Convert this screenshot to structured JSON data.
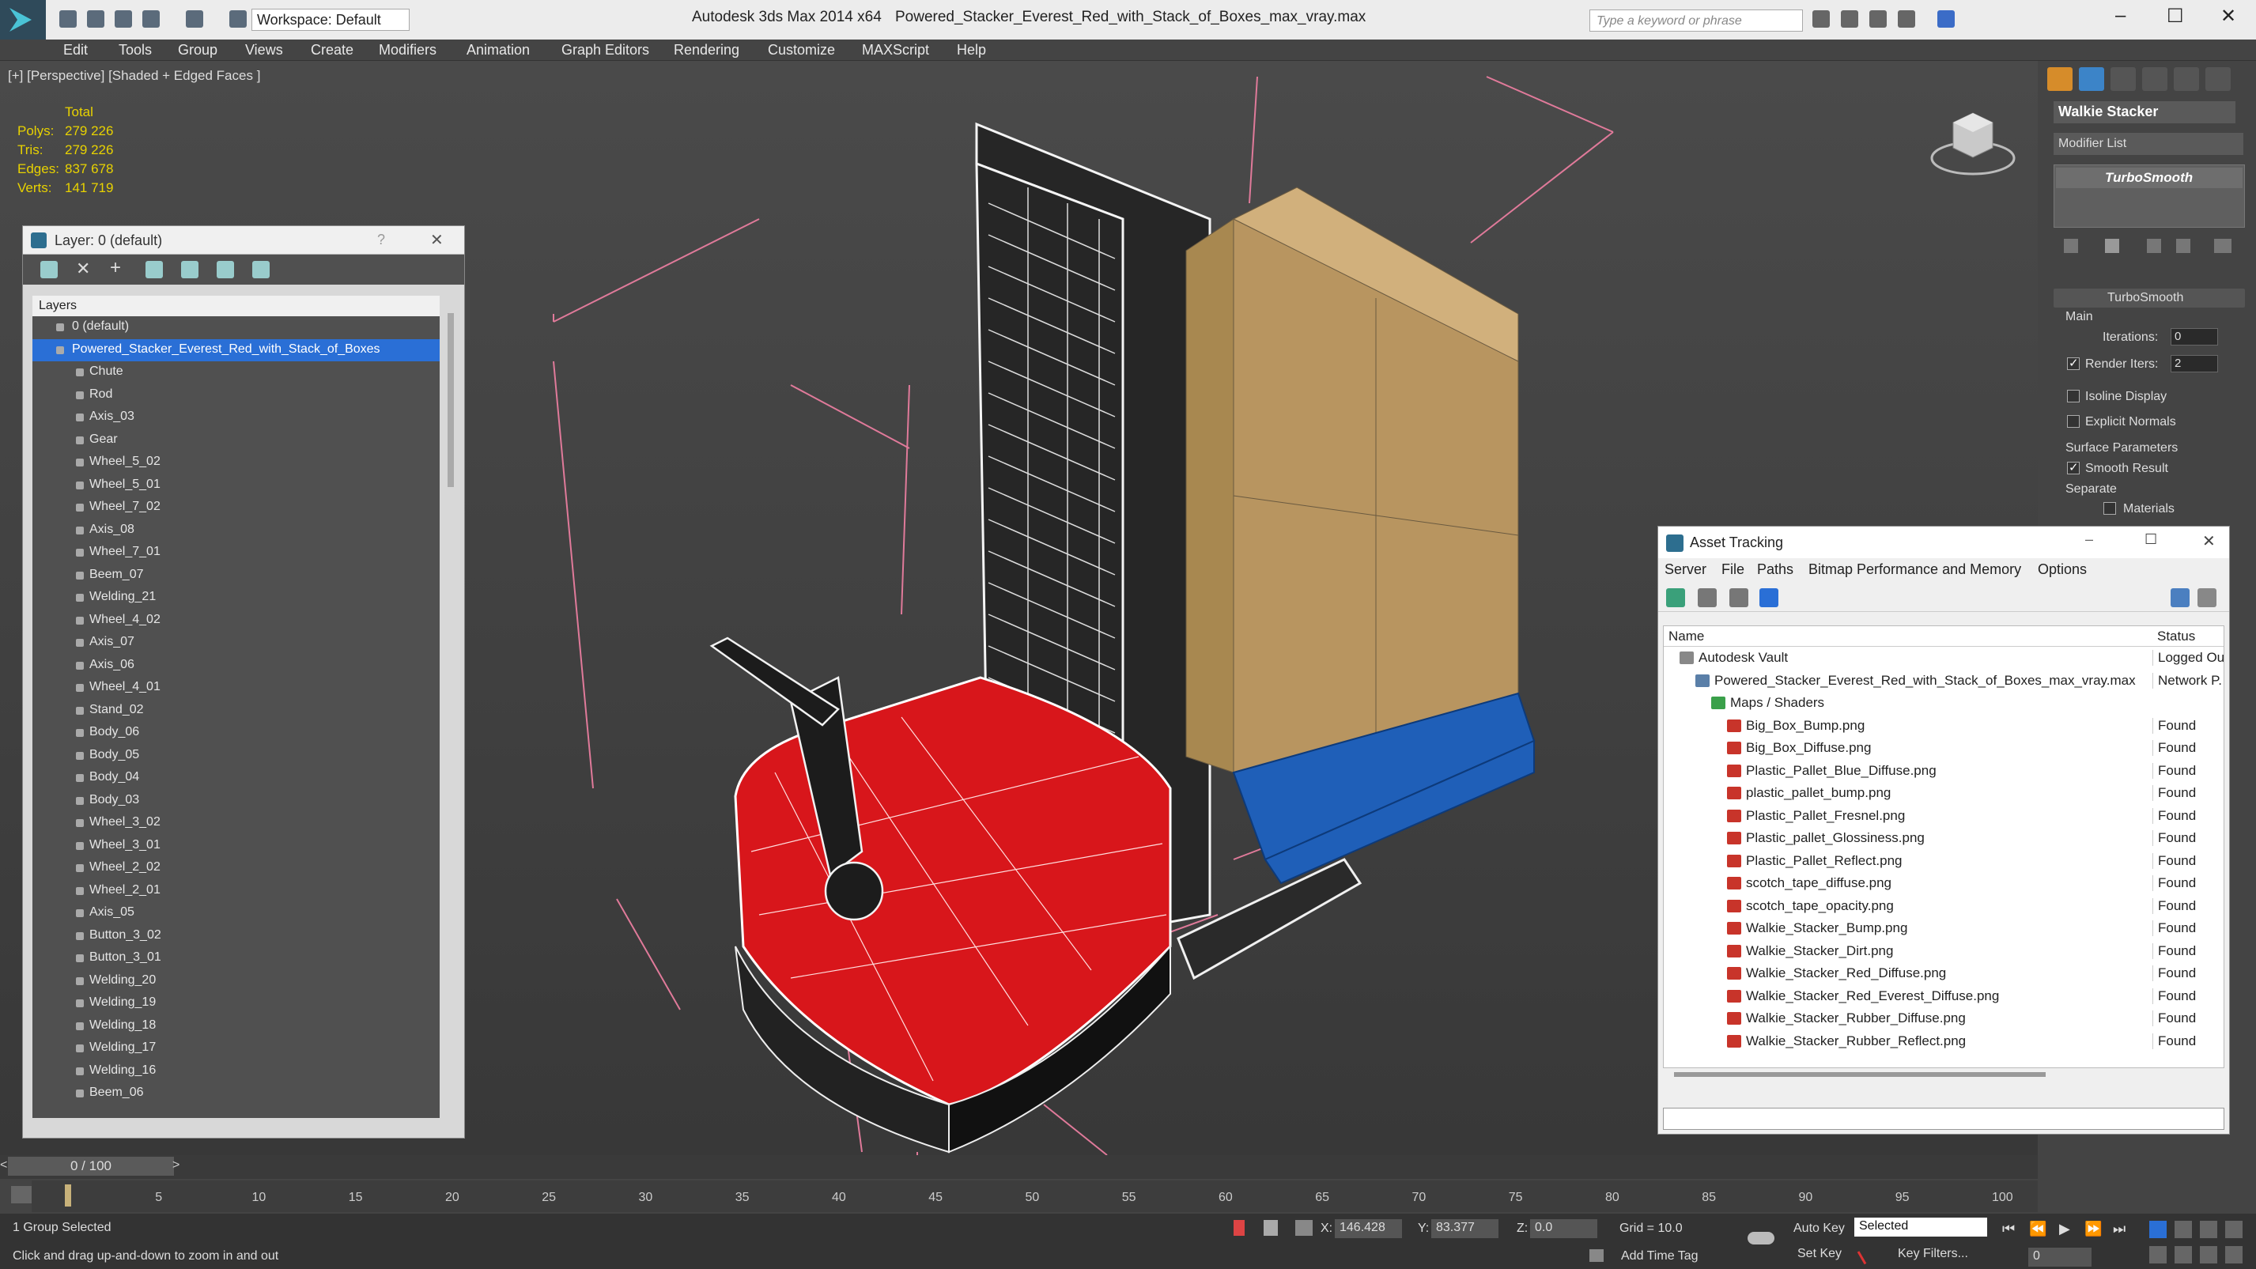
{
  "titlebar": {
    "app": "Autodesk 3ds Max  2014 x64",
    "file": "Powered_Stacker_Everest_Red_with_Stack_of_Boxes_max_vray.max",
    "workspace": "Workspace: Default",
    "search_placeholder": "Type a keyword or phrase"
  },
  "menu": [
    "Edit",
    "Tools",
    "Group",
    "Views",
    "Create",
    "Modifiers",
    "Animation",
    "Graph Editors",
    "Rendering",
    "Customize",
    "MAXScript",
    "Help"
  ],
  "viewport": {
    "label": "[+] [Perspective] [Shaded + Edged Faces ]",
    "stats": {
      "header": "Total",
      "rows": [
        {
          "k": "Polys:",
          "v": "279 226"
        },
        {
          "k": "Tris:",
          "v": "279 226"
        },
        {
          "k": "Edges:",
          "v": "837 678"
        },
        {
          "k": "Verts:",
          "v": "141 719"
        }
      ]
    }
  },
  "layer_panel": {
    "title": "Layer: 0 (default)",
    "column": "Layers",
    "default_layer": "0 (default)",
    "selected_layer": "Powered_Stacker_Everest_Red_with_Stack_of_Boxes",
    "items": [
      "Chute",
      "Rod",
      "Axis_03",
      "Gear",
      "Wheel_5_02",
      "Wheel_5_01",
      "Wheel_7_02",
      "Axis_08",
      "Wheel_7_01",
      "Beem_07",
      "Welding_21",
      "Wheel_4_02",
      "Axis_07",
      "Axis_06",
      "Wheel_4_01",
      "Stand_02",
      "Body_06",
      "Body_05",
      "Body_04",
      "Body_03",
      "Wheel_3_02",
      "Wheel_3_01",
      "Wheel_2_02",
      "Wheel_2_01",
      "Axis_05",
      "Button_3_02",
      "Button_3_01",
      "Welding_20",
      "Welding_19",
      "Welding_18",
      "Welding_17",
      "Welding_16",
      "Beem_06"
    ]
  },
  "command_panel": {
    "object_name": "Walkie Stacker",
    "modifier_list": "Modifier List",
    "stack_item": "TurboSmooth",
    "rollout_title": "TurboSmooth",
    "main": "Main",
    "iterations_label": "Iterations:",
    "iterations": "0",
    "render_iters_label": "Render Iters:",
    "render_iters": "2",
    "isoline": "Isoline Display",
    "explicit_normals": "Explicit Normals",
    "surface_params": "Surface Parameters",
    "smooth_result": "Smooth Result",
    "separate": "Separate",
    "materials": "Materials"
  },
  "asset_tracking": {
    "title": "Asset Tracking",
    "menu": [
      "Server",
      "File",
      "Paths",
      "Bitmap Performance and Memory",
      "Options"
    ],
    "col_name": "Name",
    "col_status": "Status",
    "rows": [
      {
        "name": "Autodesk Vault",
        "status": "Logged Ou",
        "level": 0,
        "icon": "vault"
      },
      {
        "name": "Powered_Stacker_Everest_Red_with_Stack_of_Boxes_max_vray.max",
        "status": "Network P.",
        "level": 1,
        "icon": "file"
      },
      {
        "name": "Maps / Shaders",
        "status": "",
        "level": 2,
        "icon": "maps"
      },
      {
        "name": "Big_Box_Bump.png",
        "status": "Found",
        "level": 3,
        "icon": "png"
      },
      {
        "name": "Big_Box_Diffuse.png",
        "status": "Found",
        "level": 3,
        "icon": "png"
      },
      {
        "name": "Plastic_Pallet_Blue_Diffuse.png",
        "status": "Found",
        "level": 3,
        "icon": "png"
      },
      {
        "name": "plastic_pallet_bump.png",
        "status": "Found",
        "level": 3,
        "icon": "png"
      },
      {
        "name": "Plastic_Pallet_Fresnel.png",
        "status": "Found",
        "level": 3,
        "icon": "png"
      },
      {
        "name": "Plastic_pallet_Glossiness.png",
        "status": "Found",
        "level": 3,
        "icon": "png"
      },
      {
        "name": "Plastic_Pallet_Reflect.png",
        "status": "Found",
        "level": 3,
        "icon": "png"
      },
      {
        "name": "scotch_tape_diffuse.png",
        "status": "Found",
        "level": 3,
        "icon": "png"
      },
      {
        "name": "scotch_tape_opacity.png",
        "status": "Found",
        "level": 3,
        "icon": "png"
      },
      {
        "name": "Walkie_Stacker_Bump.png",
        "status": "Found",
        "level": 3,
        "icon": "png"
      },
      {
        "name": "Walkie_Stacker_Dirt.png",
        "status": "Found",
        "level": 3,
        "icon": "png"
      },
      {
        "name": "Walkie_Stacker_Red_Diffuse.png",
        "status": "Found",
        "level": 3,
        "icon": "png"
      },
      {
        "name": "Walkie_Stacker_Red_Everest_Diffuse.png",
        "status": "Found",
        "level": 3,
        "icon": "png"
      },
      {
        "name": "Walkie_Stacker_Rubber_Diffuse.png",
        "status": "Found",
        "level": 3,
        "icon": "png"
      },
      {
        "name": "Walkie_Stacker_Rubber_Reflect.png",
        "status": "Found",
        "level": 3,
        "icon": "png"
      }
    ]
  },
  "timeline": {
    "frame": "0 / 100",
    "ticks": [
      "5",
      "10",
      "15",
      "20",
      "25",
      "30",
      "35",
      "40",
      "45",
      "50",
      "55",
      "60",
      "65",
      "70",
      "75",
      "80",
      "85",
      "90",
      "95",
      "100"
    ]
  },
  "status": {
    "selection": "1 Group Selected",
    "prompt": "Click and drag up-and-down to zoom in and out",
    "x_label": "X:",
    "x": "146.428",
    "y_label": "Y:",
    "y": "83.377",
    "z_label": "Z:",
    "z": "0.0",
    "grid": "Grid = 10.0",
    "add_time_tag": "Add Time Tag",
    "auto_key": "Auto Key",
    "set_key": "Set Key",
    "selected": "Selected",
    "key_filters": "Key Filters...",
    "frame": "0"
  },
  "colors": {
    "selection_blue": "#2a6fd6",
    "stats_yellow": "#e8d200",
    "stacker_red": "#d8161b",
    "pallet_blue": "#1f5fb8",
    "box_tan": "#c4a06a"
  }
}
